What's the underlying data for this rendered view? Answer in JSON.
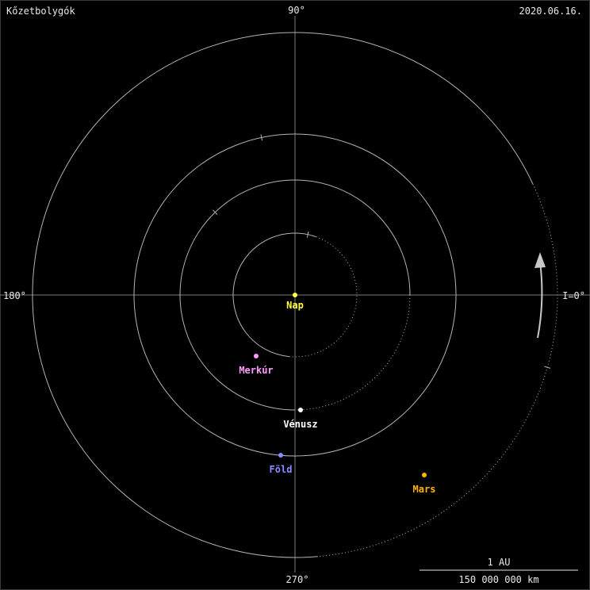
{
  "header": {
    "title": "Kőzetbolygók",
    "date": "2020.06.16."
  },
  "axes": {
    "angle_top": "90°",
    "angle_left": "180°",
    "angle_right": "I=0°",
    "angle_bottom": "270°"
  },
  "scale": {
    "unit_label": "1 AU",
    "km_label": "150 000 000 km"
  },
  "colors": {
    "orbit": "#b4b4b4",
    "axis": "#7a7a7a",
    "sun": "#ffff40",
    "mercury": "#ff9cff",
    "venus": "#ffffff",
    "earth": "#8c8cff",
    "mars": "#ffb400",
    "arrow": "#c8c8c8"
  },
  "bodies": {
    "sun": {
      "name": "Nap"
    },
    "mercury": {
      "name": "Merkúr"
    },
    "venus": {
      "name": "Vénusz"
    },
    "earth": {
      "name": "Föld"
    },
    "mars": {
      "name": "Mars"
    }
  }
}
